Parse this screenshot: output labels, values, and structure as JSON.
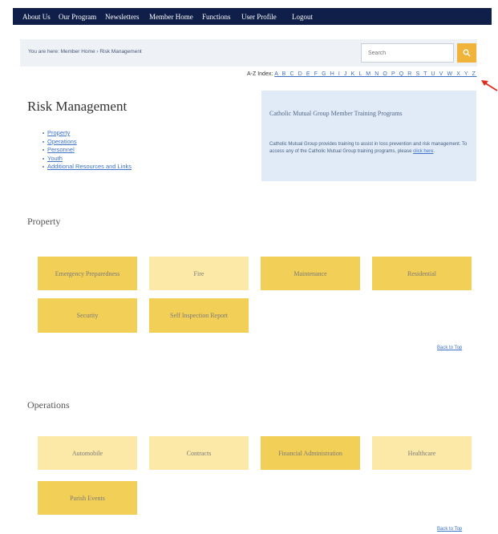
{
  "nav": {
    "items": [
      "About Us",
      "Our Program",
      "Newsletters",
      "Member Home",
      "Functions",
      "User Profile",
      "Logout"
    ]
  },
  "breadcrumb": {
    "text": "You are here: Member Home › Risk Management"
  },
  "search": {
    "placeholder": "Search"
  },
  "az_index": {
    "label": "A-Z Index:",
    "letters": "A B C D E F G H I J K L M N O P Q R S T U V W X Y Z"
  },
  "page": {
    "title": "Risk Management"
  },
  "toc": {
    "items": [
      "Property",
      "Operations",
      "Personnel",
      "Youth",
      "Additional Resources and Links"
    ]
  },
  "promo": {
    "title": "Catholic Mutual Group Member Training Programs",
    "text": "Catholic Mutual Group provides training to assist in loss prevention and risk management. To access any of the Catholic Mutual Group training programs, please ",
    "link": "click here"
  },
  "sections": {
    "property": {
      "title": "Property",
      "tiles": [
        "Emergency Preparedness",
        "Fire",
        "Maintenance",
        "Residential",
        "Security",
        "Self Inspection Report"
      ],
      "back": "Back to Top"
    },
    "operations": {
      "title": "Operations",
      "tiles": [
        "Automobile",
        "Contracts",
        "Financial Administration",
        "Healthcare",
        "Parish Events"
      ],
      "back": "Back to Top"
    }
  },
  "colors": {
    "nav_bg": "#0f1f4a",
    "tile_dark": "#f2cf57",
    "tile_light": "#fce9a8",
    "link": "#3d73c9",
    "search_button": "#f0b43a",
    "arrow": "#e02a1c"
  }
}
